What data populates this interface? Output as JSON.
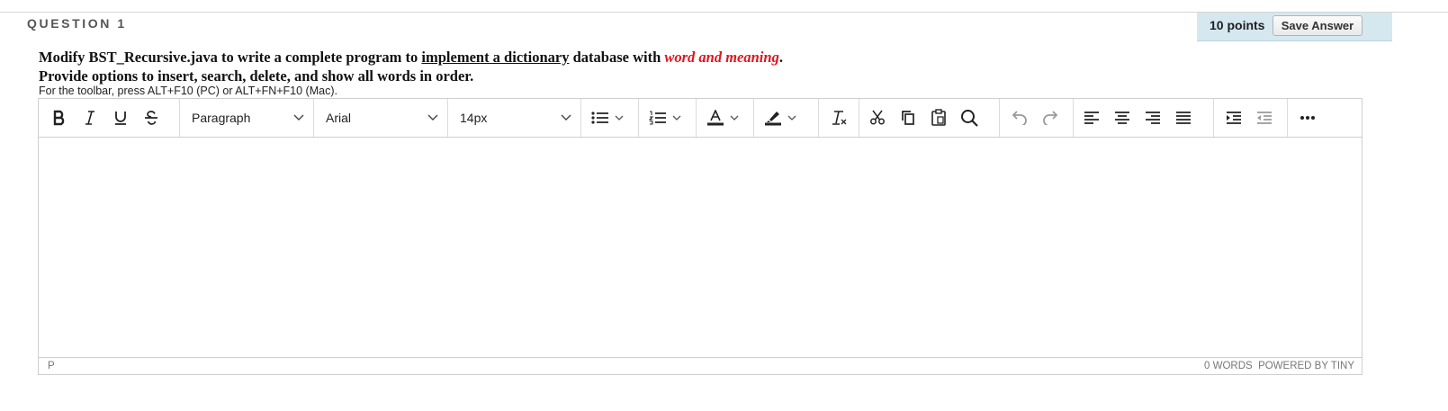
{
  "question": {
    "title": "QUESTION 1",
    "points": "10 points",
    "save_label": "Save Answer",
    "line1_a": "Modify BST_Recursive.java  to write a complete program to ",
    "line1_u": "implement a dictionary",
    "line1_b": " database with ",
    "line1_red": "word and meaning",
    "line1_end": ".",
    "line2": "Provide options to insert, search, delete, and show all words in order.",
    "hint": "For the toolbar, press ALT+F10 (PC) or ALT+FN+F10 (Mac).",
    "accent_red": "#e0141e"
  },
  "editor": {
    "toolbar": {
      "block_format": "Paragraph",
      "font_family": "Arial",
      "font_size": "14px",
      "icons": [
        "bold-icon",
        "italic-icon",
        "underline-icon",
        "strikethrough-icon",
        "bullet-list-icon",
        "numbered-list-icon",
        "text-color-icon",
        "highlight-icon",
        "clear-formatting-icon",
        "cut-icon",
        "copy-icon",
        "paste-icon",
        "find-icon",
        "undo-icon",
        "redo-icon",
        "align-left-icon",
        "align-center-icon",
        "align-right-icon",
        "justify-icon",
        "indent-icon",
        "outdent-icon",
        "more-icon"
      ]
    },
    "status_path": "P",
    "word_count": "0 WORDS",
    "powered_by": "POWERED BY TINY"
  }
}
